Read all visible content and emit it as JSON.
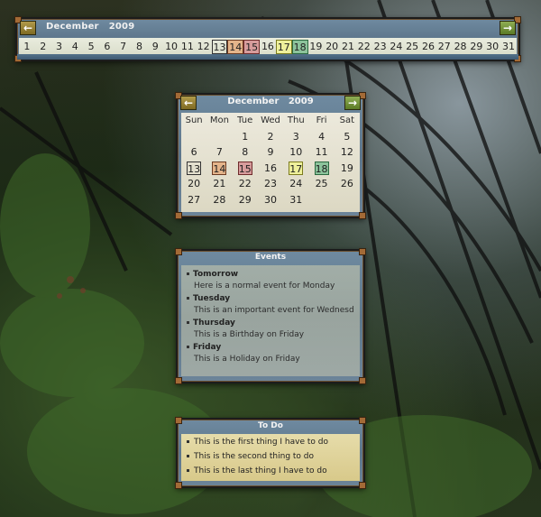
{
  "strip": {
    "month": "December",
    "year": "2009",
    "days": [
      "1",
      "2",
      "3",
      "4",
      "5",
      "6",
      "7",
      "8",
      "9",
      "10",
      "11",
      "12",
      "13",
      "14",
      "15",
      "16",
      "17",
      "18",
      "19",
      "20",
      "21",
      "22",
      "23",
      "24",
      "25",
      "26",
      "27",
      "28",
      "29",
      "30",
      "31"
    ]
  },
  "calendar": {
    "month": "December",
    "year": "2009",
    "weekdays": [
      "Sun",
      "Mon",
      "Tue",
      "Wed",
      "Thu",
      "Fri",
      "Sat"
    ],
    "weeks": [
      [
        "",
        "",
        "1",
        "2",
        "3",
        "4",
        "5"
      ],
      [
        "6",
        "7",
        "8",
        "9",
        "10",
        "11",
        "12"
      ],
      [
        "13",
        "14",
        "15",
        "16",
        "17",
        "18",
        "19"
      ],
      [
        "20",
        "21",
        "22",
        "23",
        "24",
        "25",
        "26"
      ],
      [
        "27",
        "28",
        "29",
        "30",
        "31",
        "",
        ""
      ]
    ]
  },
  "events": {
    "title": "Events",
    "items": [
      {
        "day": "Tomorrow",
        "text": "Here is a normal event for Monday"
      },
      {
        "day": "Tuesday",
        "text": "This is an important event for Wednesday..."
      },
      {
        "day": "Thursday",
        "text": "This is a Birthday on Friday"
      },
      {
        "day": "Friday",
        "text": "This is a Holiday on Friday"
      }
    ]
  },
  "todo": {
    "title": "To Do",
    "items": [
      "This is the first thing I have to do",
      "This is the second thing to do",
      "This is the last thing I have to do"
    ]
  },
  "icons": {
    "prev": "arrow-left-icon",
    "next": "arrow-right-icon"
  },
  "colors": {
    "today": "#333333",
    "day14": "#e4b48a",
    "day15": "#d79c9c",
    "day17": "#eef09b",
    "day18": "#8cc39b"
  }
}
